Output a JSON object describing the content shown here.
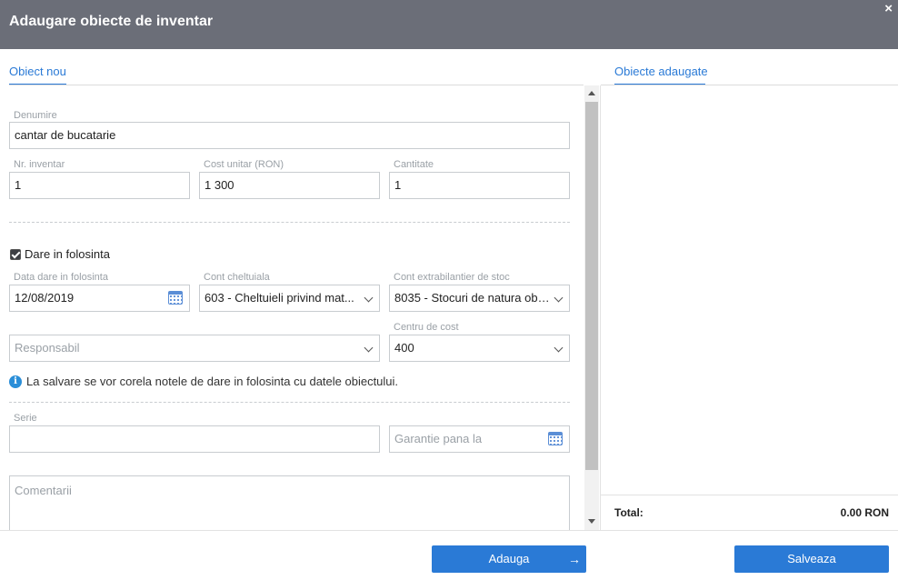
{
  "dialog": {
    "title": "Adaugare obiecte de inventar",
    "close_glyph": "×"
  },
  "tabs": {
    "left": "Obiect nou",
    "right": "Obiecte adaugate"
  },
  "form": {
    "denumire": {
      "label": "Denumire",
      "value": "cantar de bucatarie"
    },
    "nr_inventar": {
      "label": "Nr. inventar",
      "value": "1"
    },
    "cost_unitar": {
      "label": "Cost unitar (RON)",
      "value": "1 300"
    },
    "cantitate": {
      "label": "Cantitate",
      "value": "1"
    },
    "dare_in_folosinta": {
      "label": "Dare in folosinta",
      "checked": true
    },
    "data_dare": {
      "label": "Data dare in folosinta",
      "value": "12/08/2019",
      "icon": "calendar-icon"
    },
    "cont_cheltuiala": {
      "label": "Cont cheltuiala",
      "value": "603 - Cheltuieli privind mat..."
    },
    "cont_extrabilantier": {
      "label": "Cont extrabilantier de stoc",
      "value": "8035 - Stocuri de natura obi..."
    },
    "responsabil": {
      "placeholder": "Responsabil"
    },
    "centru_cost": {
      "label": "Centru de cost",
      "value": "400"
    },
    "info": {
      "icon": "info-icon",
      "glyph": "i",
      "text": "La salvare se vor corela notele de dare in folosinta cu datele obiectului."
    },
    "serie": {
      "label": "Serie",
      "value": ""
    },
    "garantie": {
      "placeholder": "Garantie pana la",
      "icon": "calendar-icon"
    },
    "comentarii": {
      "placeholder": "Comentarii"
    }
  },
  "summary": {
    "total_label": "Total:",
    "total_value": "0.00 RON"
  },
  "buttons": {
    "adauga": "Adauga",
    "adauga_arrow": "→",
    "salveaza": "Salveaza"
  },
  "colors": {
    "titlebar": "#6b6e78",
    "accent": "#2a7ad6"
  }
}
